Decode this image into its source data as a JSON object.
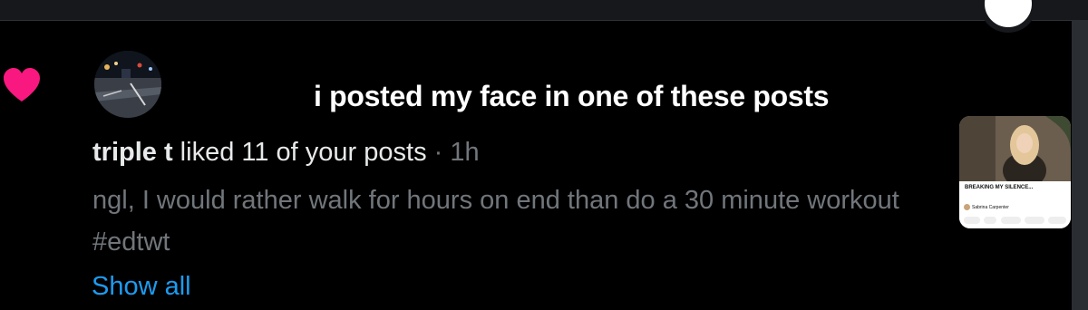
{
  "notification": {
    "overlay_caption": "i posted my face in one of these posts",
    "username": "triple t",
    "action": " liked 11 of your posts",
    "separator": " · ",
    "time": "1h",
    "post_text": "ngl, I would rather walk for hours on end than do a 30 minute workout #edtwt",
    "show_all_label": "Show all"
  },
  "thumbnail": {
    "title": "BREAKING MY SILENCE...",
    "channel": "Sabrina Carpenter"
  },
  "colors": {
    "background": "#000000",
    "text_primary": "#e7e9ea",
    "text_secondary": "#71767b",
    "link": "#1d9bf0",
    "heart": "#f91880"
  },
  "icons": {
    "like": "heart-icon"
  }
}
